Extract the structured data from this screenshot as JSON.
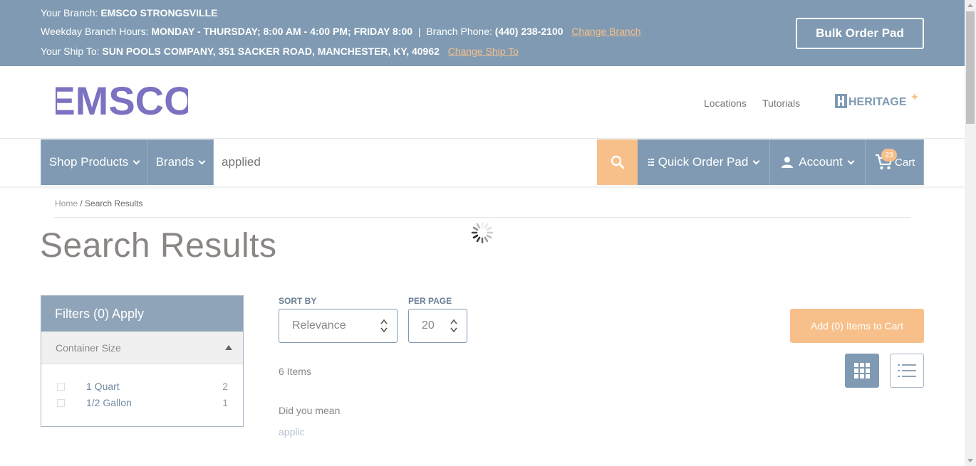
{
  "branch_bar": {
    "branch_label": "Your Branch:",
    "branch_name": "EMSCO STRONGSVILLE",
    "hours_label": "Weekday Branch Hours:",
    "hours_value": "MONDAY - THURSDAY; 8:00 AM - 4:00 PM; FRIDAY 8:00",
    "separator": "|",
    "phone_label": "Branch Phone:",
    "phone_value": "(440) 238-2100",
    "change_branch": "Change Branch",
    "ship_label": "Your Ship To:",
    "ship_value": "SUN POOLS COMPANY, 351 SACKER ROAD, MANCHESTER, KY, 40962",
    "change_ship": "Change Ship To",
    "bulk_order": "Bulk Order Pad"
  },
  "header": {
    "logo_text": "EMSCO",
    "locations": "Locations",
    "tutorials": "Tutorials",
    "heritage_logo_text": "HERITAGE"
  },
  "nav": {
    "shop_products": "Shop Products",
    "brands": "Brands",
    "search_value": "applied",
    "quick_order": "Quick Order Pad",
    "account": "Account",
    "cart": "Cart",
    "cart_count": "23"
  },
  "breadcrumb": {
    "home": "Home",
    "separator": "/",
    "current": "Search Results"
  },
  "page_title": "Search Results",
  "filters": {
    "header": "Filters (0) Apply",
    "group": "Container Size",
    "options": [
      {
        "label": "1 Quart",
        "count": "2"
      },
      {
        "label": "1/2 Gallon",
        "count": "1"
      }
    ]
  },
  "results": {
    "sort_label": "SORT BY",
    "sort_value": "Relevance",
    "per_page_label": "PER PAGE",
    "per_page_value": "20",
    "add_to_cart": "Add (0) Items to Cart",
    "items_count": "6 Items",
    "did_you_mean": "Did you mean",
    "suggestion": "applic"
  },
  "colors": {
    "primary": "#7f9ab2",
    "accent": "#f7c08a",
    "logo": "#7b72c2"
  }
}
